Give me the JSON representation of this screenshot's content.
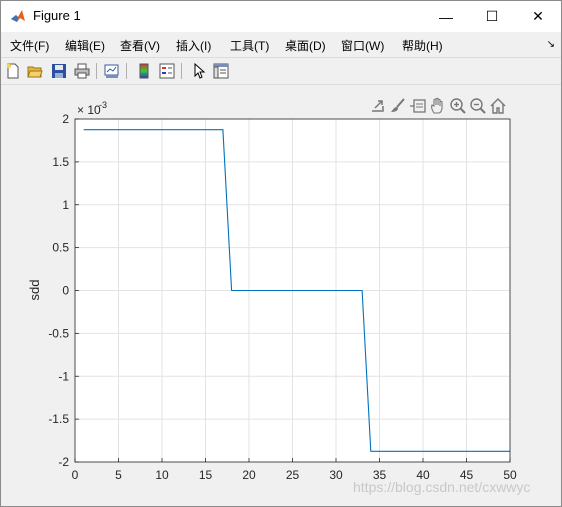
{
  "window": {
    "title": "Figure 1",
    "minimize_glyph": "—",
    "maximize_glyph": "☐",
    "close_glyph": "✕"
  },
  "menu": {
    "items": [
      {
        "label": "文件(F)"
      },
      {
        "label": "编辑(E)"
      },
      {
        "label": "查看(V)"
      },
      {
        "label": "插入(I)"
      },
      {
        "label": "工具(T)"
      },
      {
        "label": "桌面(D)"
      },
      {
        "label": "窗口(W)"
      },
      {
        "label": "帮助(H)"
      }
    ],
    "overflow_glyph": "↘"
  },
  "toolbar": {
    "icons": [
      "new-figure-icon",
      "open-file-icon",
      "save-icon",
      "print-icon",
      "link-plot-icon",
      "colorbar-icon",
      "legend-icon",
      "edit-plot-icon",
      "property-inspector-icon"
    ]
  },
  "axes_toolbar": {
    "icons": [
      "export-icon",
      "brush-icon",
      "data-tips-icon",
      "pan-icon",
      "zoom-in-icon",
      "zoom-out-icon",
      "home-icon"
    ]
  },
  "chart_data": {
    "type": "line",
    "title": "",
    "xlabel": "",
    "ylabel": "sdd",
    "y_exponent_label": "× 10",
    "y_exponent": "-3",
    "xlim": [
      0,
      50
    ],
    "ylim": [
      -2,
      2
    ],
    "xticks": [
      "0",
      "5",
      "10",
      "15",
      "20",
      "25",
      "30",
      "35",
      "40",
      "45",
      "50"
    ],
    "yticks": [
      "2",
      "1.5",
      "1",
      "0.5",
      "0",
      "-0.5",
      "-1",
      "-1.5",
      "-2"
    ],
    "grid": true,
    "series_color": "#0072bd",
    "x": [
      1,
      17,
      18,
      33,
      34,
      50
    ],
    "y": [
      1.875,
      1.875,
      0,
      0,
      -1.875,
      -1.875
    ]
  },
  "watermark": "https://blog.csdn.net/cxwwyc"
}
